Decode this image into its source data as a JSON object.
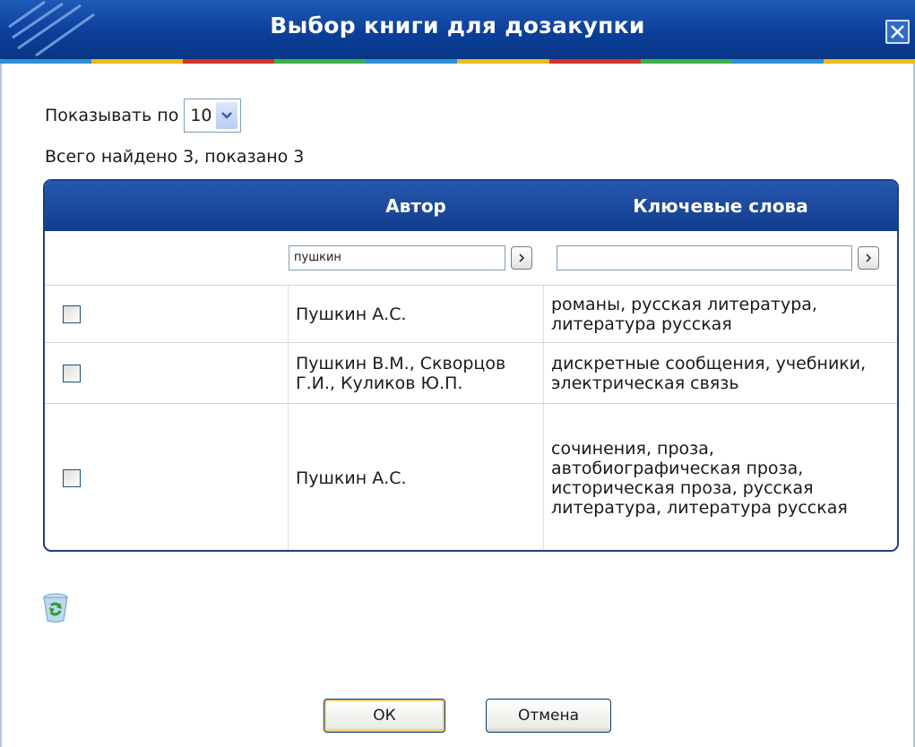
{
  "dialog": {
    "title": "Выбор книги для дозакупки"
  },
  "paging": {
    "label": "Показывать по",
    "page_size": "10",
    "summary": "Всего найдено 3, показано 3"
  },
  "table": {
    "columns": [
      "",
      "Автор",
      "Ключевые слова"
    ],
    "filters": {
      "author_value": "пушкин",
      "keywords_value": ""
    },
    "rows": [
      {
        "checked": false,
        "author": "Пушкин А.С.",
        "keywords": "романы, русская литература, литература русская"
      },
      {
        "checked": false,
        "author": "Пушкин В.М., Скворцов Г.И., Куликов Ю.П.",
        "keywords": "дискретные сообщения, учебники, электрическая связь"
      },
      {
        "checked": false,
        "author": "Пушкин А.С.",
        "keywords": "сочинения, проза, автобиографическая проза, историческая проза, русская литература, литература русская"
      }
    ]
  },
  "buttons": {
    "ok": "ОК",
    "cancel": "Отмена"
  },
  "icons": {
    "close": "close-icon",
    "dropdown": "chevron-down-icon",
    "go": "chevron-right-icon",
    "recycle": "recycle-bin-icon"
  },
  "colors": {
    "title_bar": "#0b3f9a",
    "table_header": "#1c4a9e",
    "ok_highlight": "#f5c66a"
  }
}
